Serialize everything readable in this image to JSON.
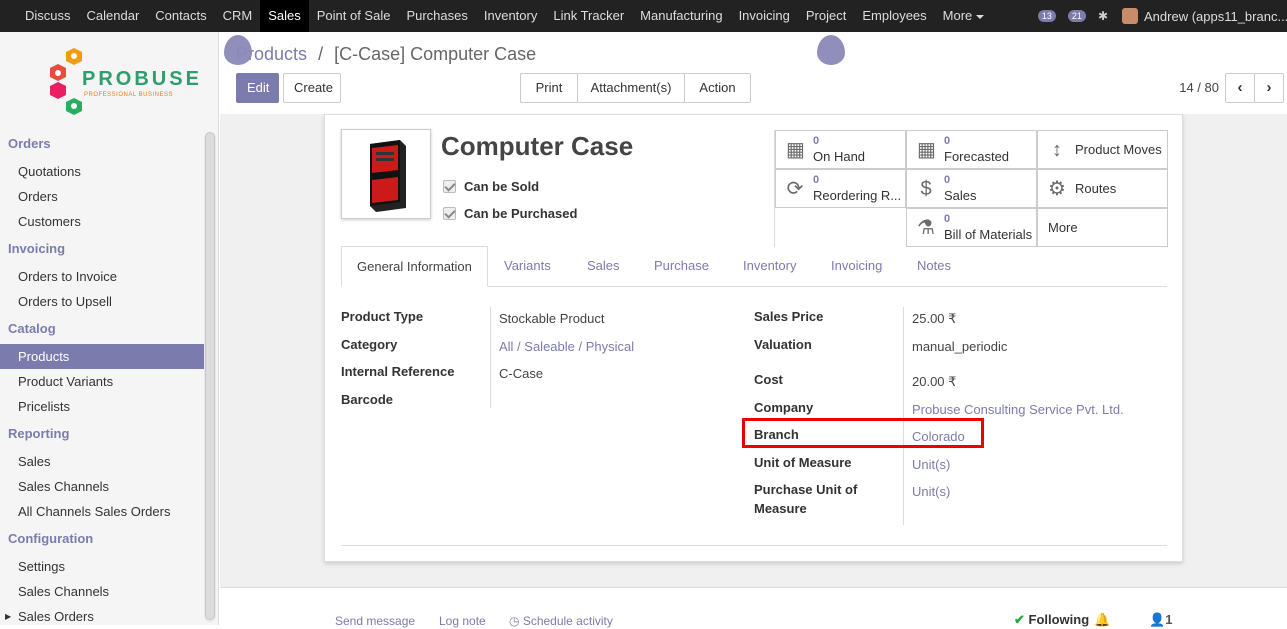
{
  "topbar": {
    "menu": [
      "Discuss",
      "Calendar",
      "Contacts",
      "CRM",
      "Sales",
      "Point of Sale",
      "Purchases",
      "Inventory",
      "Link Tracker",
      "Manufacturing",
      "Invoicing",
      "Project",
      "Employees",
      "More"
    ],
    "active": "Sales",
    "badge_activity": "13",
    "badge_messages": "21",
    "user": "Andrew (apps11_branc..."
  },
  "logo": {
    "name": "PROBUSE",
    "tagline": "PROFESSIONAL BUSINESS"
  },
  "sidebar": {
    "sections": [
      {
        "title": "Orders",
        "items": [
          "Quotations",
          "Orders",
          "Customers"
        ]
      },
      {
        "title": "Invoicing",
        "items": [
          "Orders to Invoice",
          "Orders to Upsell"
        ]
      },
      {
        "title": "Catalog",
        "items": [
          "Products",
          "Product Variants",
          "Pricelists"
        ]
      },
      {
        "title": "Reporting",
        "items": [
          "Sales",
          "Sales Channels",
          "All Channels Sales Orders"
        ]
      },
      {
        "title": "Configuration",
        "items": [
          "Settings",
          "Sales Channels",
          "Sales Orders"
        ]
      }
    ],
    "active_item": "Products"
  },
  "control": {
    "breadcrumb_parent": "Products",
    "breadcrumb_sep": "/",
    "breadcrumb_current": "[C-Case] Computer Case",
    "edit": "Edit",
    "create": "Create",
    "print": "Print",
    "attachments": "Attachment(s)",
    "action": "Action",
    "pager": "14 / 80"
  },
  "product": {
    "name": "Computer Case",
    "can_be_sold": "Can be Sold",
    "can_be_purchased": "Can be Purchased"
  },
  "smart_buttons": {
    "on_hand": {
      "num": "0",
      "label": "On Hand"
    },
    "forecasted": {
      "num": "0",
      "label": "Forecasted"
    },
    "product_moves": "Product Moves",
    "reordering": {
      "num": "0",
      "label": "Reordering R..."
    },
    "sales": {
      "num": "0",
      "label": "Sales"
    },
    "routes": "Routes",
    "bom": {
      "num": "0",
      "label": "Bill of Materials"
    },
    "more": "More"
  },
  "tabs": [
    "General Information",
    "Variants",
    "Sales",
    "Purchase",
    "Inventory",
    "Invoicing",
    "Notes"
  ],
  "general": {
    "product_type_label": "Product Type",
    "product_type": "Stockable Product",
    "category_label": "Category",
    "category": "All / Saleable / Physical",
    "internal_ref_label": "Internal Reference",
    "internal_ref": "C-Case",
    "barcode_label": "Barcode",
    "sales_price_label": "Sales Price",
    "sales_price": "25.00 ₹",
    "valuation_label": "Valuation",
    "valuation": "manual_periodic",
    "cost_label": "Cost",
    "cost": "20.00 ₹",
    "company_label": "Company",
    "company": "Probuse Consulting Service Pvt. Ltd.",
    "branch_label": "Branch",
    "branch": "Colorado",
    "uom_label": "Unit of Measure",
    "uom": "Unit(s)",
    "purchase_uom_label_1": "Purchase Unit of",
    "purchase_uom_label_2": "Measure",
    "purchase_uom": "Unit(s)"
  },
  "chatter": {
    "send": "Send message",
    "log": "Log note",
    "schedule": "Schedule activity",
    "following": "Following",
    "followers": "1"
  },
  "colors": {
    "accent": "#7c7bad",
    "topbar": "#222222",
    "highlight": "#ee0000"
  }
}
